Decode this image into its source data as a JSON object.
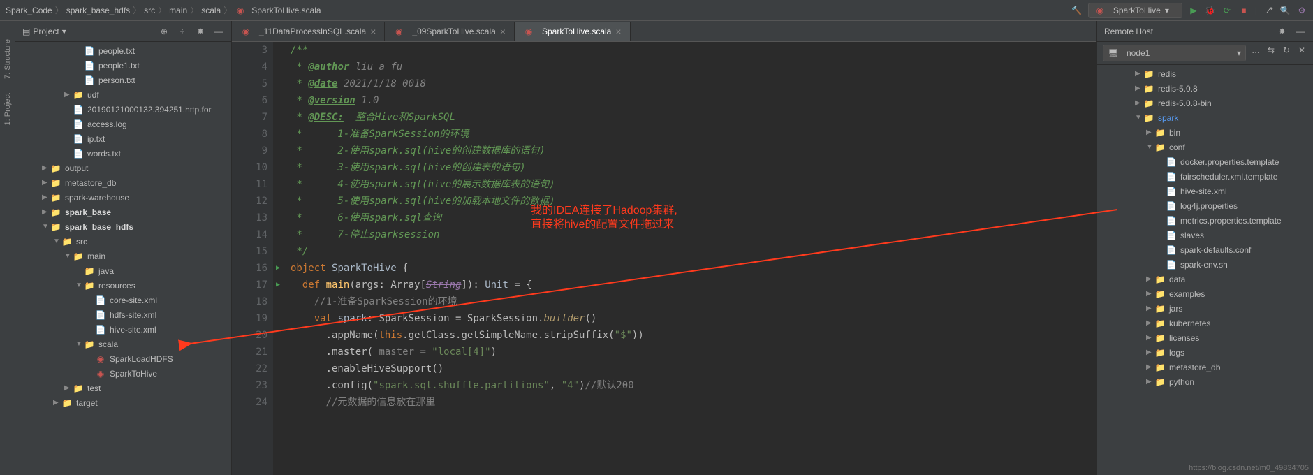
{
  "breadcrumb": [
    "Spark_Code",
    "spark_base_hdfs",
    "src",
    "main",
    "scala",
    "SparkToHive.scala"
  ],
  "runConfig": "SparkToHive",
  "panels": {
    "project": "Project",
    "remote": "Remote Host",
    "structure": "7: Structure",
    "proj_side": "1: Project"
  },
  "project_tree": [
    {
      "d": 5,
      "i": "file",
      "l": "people.txt"
    },
    {
      "d": 5,
      "i": "file",
      "l": "people1.txt"
    },
    {
      "d": 5,
      "i": "file",
      "l": "person.txt"
    },
    {
      "d": 4,
      "a": "▶",
      "i": "folder",
      "l": "udf"
    },
    {
      "d": 4,
      "i": "file",
      "l": "20190121000132.394251.http.for"
    },
    {
      "d": 4,
      "i": "file",
      "l": "access.log"
    },
    {
      "d": 4,
      "i": "file",
      "l": "ip.txt"
    },
    {
      "d": 4,
      "i": "file",
      "l": "words.txt"
    },
    {
      "d": 2,
      "a": "▶",
      "i": "folder",
      "l": "output"
    },
    {
      "d": 2,
      "a": "▶",
      "i": "folder",
      "l": "metastore_db"
    },
    {
      "d": 2,
      "a": "▶",
      "i": "folder",
      "l": "spark-warehouse"
    },
    {
      "d": 2,
      "a": "▶",
      "i": "folder",
      "l": "spark_base",
      "bold": true
    },
    {
      "d": 2,
      "a": "▼",
      "i": "folder",
      "l": "spark_base_hdfs",
      "bold": true
    },
    {
      "d": 3,
      "a": "▼",
      "i": "dir-src",
      "l": "src"
    },
    {
      "d": 4,
      "a": "▼",
      "i": "folder",
      "l": "main"
    },
    {
      "d": 5,
      "i": "folder",
      "l": "java"
    },
    {
      "d": 5,
      "a": "▼",
      "i": "res",
      "l": "resources"
    },
    {
      "d": 6,
      "i": "xml",
      "l": "core-site.xml"
    },
    {
      "d": 6,
      "i": "xml",
      "l": "hdfs-site.xml"
    },
    {
      "d": 6,
      "i": "xml",
      "l": "hive-site.xml"
    },
    {
      "d": 5,
      "a": "▼",
      "i": "folder",
      "l": "scala"
    },
    {
      "d": 6,
      "i": "scala",
      "l": "SparkLoadHDFS"
    },
    {
      "d": 6,
      "i": "scala",
      "l": "SparkToHive"
    },
    {
      "d": 4,
      "a": "▶",
      "i": "folder",
      "l": "test"
    },
    {
      "d": 3,
      "a": "▶",
      "i": "folder",
      "l": "target"
    }
  ],
  "tabs": [
    {
      "l": "_11DataProcessInSQL.scala",
      "i": "scala"
    },
    {
      "l": "_09SparkToHive.scala",
      "i": "scala"
    },
    {
      "l": "SparkToHive.scala",
      "i": "scala",
      "active": true
    }
  ],
  "code": {
    "start": 3,
    "lines": [
      "/**",
      " * <t>@author</t> <p>liu a fu</p>",
      " * <t>@date</t> <p>2021/1/18 0018</p>",
      " * <t>@version</t> <p>1.0</p>",
      " * <t>@DESC:</t>  整合Hive和SparkSQL",
      " *      1-准备SparkSession的环境",
      " *      2-使用spark.sql(hive的创建数据库的语句)",
      " *      3-使用spark.sql(hive的创建表的语句)",
      " *      4-使用spark.sql(hive的展示数据库表的语句)",
      " *      5-使用spark.sql(hive的加载本地文件的数据)",
      " *      6-使用spark.sql查询",
      " *      7-停止sparksession",
      " */",
      "<k>object</k> <y>SparkToHive</y> {",
      "  <k>def</k> <fn>main</fn>(args: Array[<l>String</l>]): <y>Unit</y> = {",
      "    <c>//1-准备SparkSession的环境</c>",
      "    <k>val</k> <y>spark</y>: SparkSession = SparkSession.<i>builder</i>()",
      "      .appName(<k>this</k>.getClass.getSimpleName.stripSuffix(<s>\"$\"</s>))",
      "      .master( <pm>master = </pm><s>\"local[4]\"</s>)",
      "      .enableHiveSupport()",
      "      .config(<s>\"spark.sql.shuffle.partitions\"</s>, <s>\"4\"</s>)<c>//默认200</c>",
      "      <c>//元数据的信息放在那里</c>"
    ],
    "run_icons": [
      16,
      17
    ]
  },
  "remote": {
    "host": "node1",
    "tree": [
      {
        "d": 3,
        "a": "▶",
        "i": "folder",
        "l": "redis"
      },
      {
        "d": 3,
        "a": "▶",
        "i": "folder",
        "l": "redis-5.0.8"
      },
      {
        "d": 3,
        "a": "▶",
        "i": "folder",
        "l": "redis-5.0.8-bin"
      },
      {
        "d": 3,
        "a": "▼",
        "i": "folder",
        "l": "spark",
        "hl": true
      },
      {
        "d": 4,
        "a": "▶",
        "i": "folder",
        "l": "bin"
      },
      {
        "d": 4,
        "a": "▼",
        "i": "folder",
        "l": "conf"
      },
      {
        "d": 5,
        "i": "file",
        "l": "docker.properties.template"
      },
      {
        "d": 5,
        "i": "file",
        "l": "fairscheduler.xml.template"
      },
      {
        "d": 5,
        "i": "xml",
        "l": "hive-site.xml"
      },
      {
        "d": 5,
        "i": "file",
        "l": "log4j.properties"
      },
      {
        "d": 5,
        "i": "file",
        "l": "metrics.properties.template"
      },
      {
        "d": 5,
        "i": "file",
        "l": "slaves"
      },
      {
        "d": 5,
        "i": "file",
        "l": "spark-defaults.conf"
      },
      {
        "d": 5,
        "i": "file",
        "l": "spark-env.sh"
      },
      {
        "d": 4,
        "a": "▶",
        "i": "folder",
        "l": "data"
      },
      {
        "d": 4,
        "a": "▶",
        "i": "folder",
        "l": "examples"
      },
      {
        "d": 4,
        "a": "▶",
        "i": "folder",
        "l": "jars"
      },
      {
        "d": 4,
        "a": "▶",
        "i": "folder",
        "l": "kubernetes"
      },
      {
        "d": 4,
        "a": "▶",
        "i": "folder",
        "l": "licenses"
      },
      {
        "d": 4,
        "a": "▶",
        "i": "folder",
        "l": "logs"
      },
      {
        "d": 4,
        "a": "▶",
        "i": "folder",
        "l": "metastore_db"
      },
      {
        "d": 4,
        "a": "▶",
        "i": "folder",
        "l": "python"
      }
    ]
  },
  "annotation": {
    "text": "我的IDEA连接了Hadoop集群,\n直接将hive的配置文件拖过来"
  },
  "watermark": "https://blog.csdn.net/m0_49834705"
}
